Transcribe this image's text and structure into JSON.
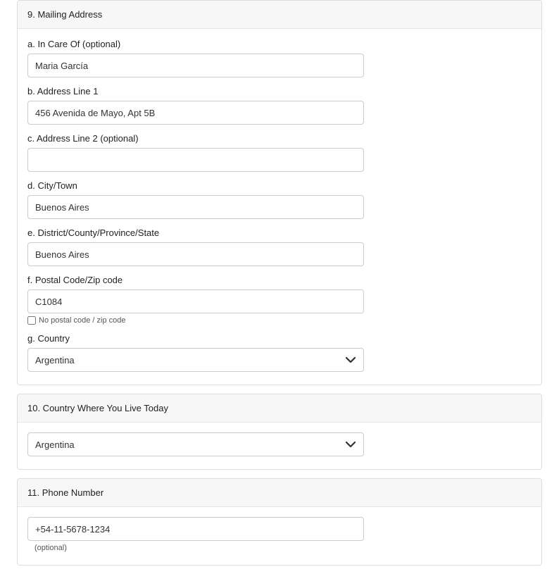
{
  "sections": {
    "mailing": {
      "title": "9. Mailing Address",
      "fields": {
        "in_care_of": {
          "label": "a. In Care Of (optional)",
          "value": "Maria García"
        },
        "address1": {
          "label": "b. Address Line 1",
          "value": "456 Avenida de Mayo, Apt 5B"
        },
        "address2": {
          "label": "c. Address Line 2 (optional)",
          "value": ""
        },
        "city": {
          "label": "d. City/Town",
          "value": "Buenos Aires"
        },
        "district": {
          "label": "e. District/County/Province/State",
          "value": "Buenos Aires"
        },
        "postal": {
          "label": "f. Postal Code/Zip code",
          "value": "C1084"
        },
        "no_postal": {
          "label": "No postal code / zip code"
        },
        "country": {
          "label": "g. Country",
          "value": "Argentina"
        }
      }
    },
    "country_today": {
      "title": "10. Country Where You Live Today",
      "value": "Argentina"
    },
    "phone": {
      "title": "11. Phone Number",
      "value": "+54-11-5678-1234",
      "helper": "(optional)"
    }
  }
}
